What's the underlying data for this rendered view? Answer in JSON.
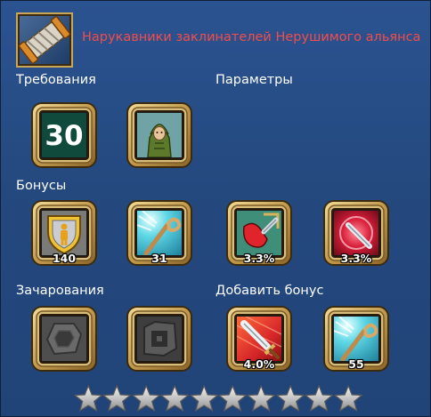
{
  "item": {
    "icon": "wrist-wraps-icon",
    "title": "Нарукавники заклинателей Нерушимого альянса",
    "title_color": "#f24c4c"
  },
  "sections": {
    "requirements": "Требования",
    "parameters": "Параметры",
    "bonuses": "Бонусы",
    "enchantments": "Зачарования",
    "add_bonus": "Добавить бонус"
  },
  "requirements": {
    "level": "30",
    "class_icon": "hooded-mage-icon"
  },
  "bonuses": [
    {
      "icon": "shield-person-icon",
      "value": "140"
    },
    {
      "icon": "magic-staff-icon",
      "value": "31"
    },
    {
      "icon": "red-crystal-sword-icon",
      "value": "3.3%"
    },
    {
      "icon": "crimson-sword-icon",
      "value": "3.3%"
    }
  ],
  "enchantments": [
    {
      "icon": "empty-round-rune-slot-icon"
    },
    {
      "icon": "empty-square-rune-slot-icon"
    }
  ],
  "added_bonuses": [
    {
      "icon": "red-sword-icon",
      "value": "4.0%"
    },
    {
      "icon": "magic-staff-icon",
      "value": "55"
    }
  ],
  "upgrade_stars": {
    "filled": 0,
    "total": 10
  },
  "colors": {
    "background": "#24497f",
    "frame_gold": "#c9a75a",
    "title_red": "#f24c4c"
  }
}
